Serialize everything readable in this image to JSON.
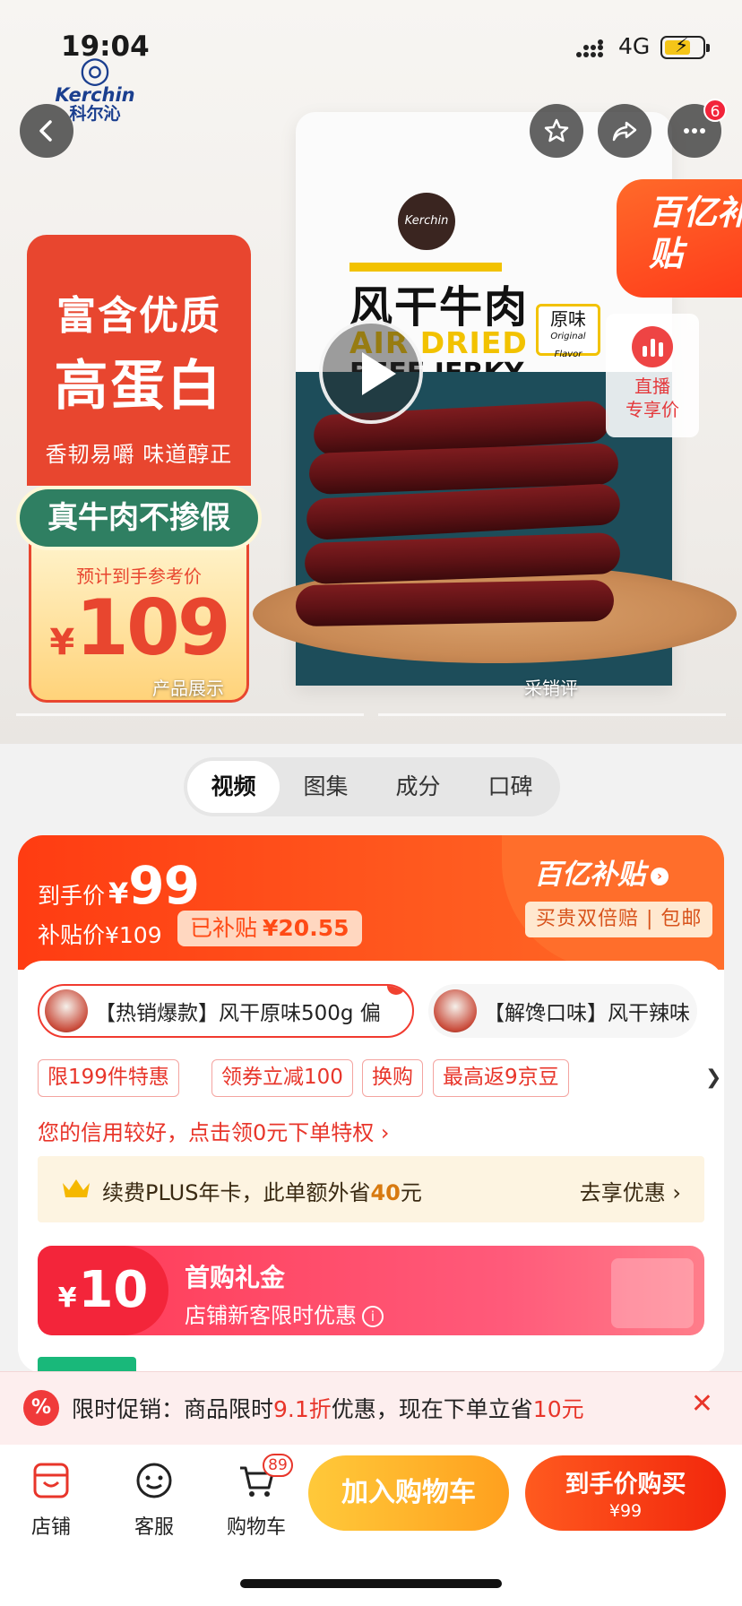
{
  "status_bar": {
    "time": "19:04",
    "network": "4G"
  },
  "brand": {
    "en": "Kerchin",
    "cn": "科尔沁"
  },
  "header": {
    "more_badge": "6"
  },
  "product_image": {
    "bag_cn_name": "风干牛肉",
    "bag_en_line1": "AIR DRIED",
    "bag_en_line2": "BEEF JERKY",
    "bag_flavor": "原味",
    "bag_flavor_en": "Original Flavor",
    "subsidy_tag": "百亿补贴",
    "live": {
      "line1": "直播",
      "line2": "专享价"
    },
    "promo": {
      "line1": "富含优质",
      "line2": "高蛋白",
      "line3": "香韧易嚼 味道醇正",
      "pill": "真牛肉不掺假",
      "ref_label": "预计到手参考价",
      "currency": "¥",
      "price": "109"
    },
    "segments": [
      "产品展示",
      "采销评"
    ]
  },
  "media_tabs": [
    {
      "label": "视频",
      "active": true
    },
    {
      "label": "图集",
      "active": false
    },
    {
      "label": "成分",
      "active": false
    },
    {
      "label": "口碑",
      "active": false
    }
  ],
  "price_card": {
    "final_label": "到手价",
    "currency": "¥",
    "final_price": "99",
    "subsidy_price_label": "补贴价¥109",
    "subsidized_label": "已补贴",
    "subsidized_amount": "¥20.55",
    "brand": "百亿补贴",
    "guarantee": "买贵双倍赔 | 包邮"
  },
  "variants": [
    {
      "label": "【热销爆款】风干原味500g 偏",
      "selected": true
    },
    {
      "label": "【解馋口味】风干辣味",
      "selected": false
    }
  ],
  "offers": [
    "限199件特惠",
    "领券立减100",
    "换购",
    "最高返9京豆"
  ],
  "credit_text": "您的信用较好，点击领0元下单特权 ›",
  "plus": {
    "text_prefix": "续费PLUS年卡，此单额外省",
    "amount": "40",
    "text_suffix": "元",
    "action": "去享优惠 ›"
  },
  "gift": {
    "currency": "¥",
    "amount": "10",
    "title": "首购礼金",
    "subtitle": "店铺新客限时优惠"
  },
  "notice": {
    "prefix": "限时促销：商品限时",
    "discount": "9.1折",
    "middle": "优惠，现在下单立省",
    "save": "10元",
    "icon": "%"
  },
  "bottom_bar": {
    "store": "店铺",
    "service": "客服",
    "cart": "购物车",
    "cart_count": "89",
    "add_to_cart": "加入购物车",
    "buy_label": "到手价购买",
    "buy_price": "¥99"
  }
}
